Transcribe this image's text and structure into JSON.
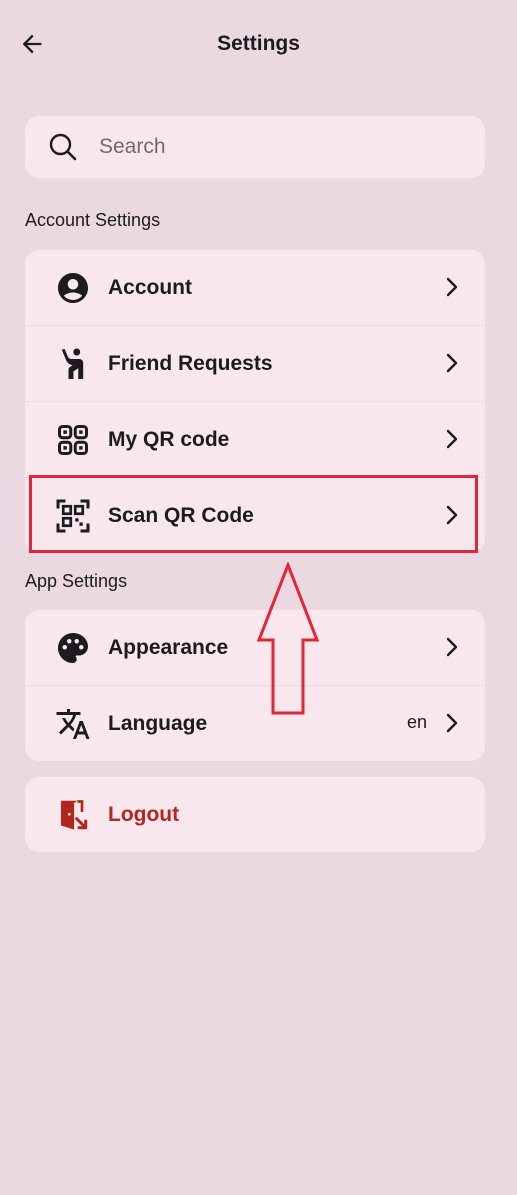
{
  "header": {
    "title": "Settings",
    "back_icon": "arrow-left-icon"
  },
  "search": {
    "placeholder": "Search",
    "value": ""
  },
  "account_section": {
    "label": "Account Settings",
    "items": [
      {
        "label": "Account",
        "icon": "account-circle-icon"
      },
      {
        "label": "Friend Requests",
        "icon": "waving-person-icon"
      },
      {
        "label": "My QR code",
        "icon": "qr-code-icon"
      },
      {
        "label": "Scan QR Code",
        "icon": "qr-scan-icon"
      }
    ]
  },
  "app_section": {
    "label": "App Settings",
    "items": [
      {
        "label": "Appearance",
        "icon": "palette-icon"
      },
      {
        "label": "Language",
        "icon": "translate-icon",
        "value": "en"
      }
    ]
  },
  "logout": {
    "label": "Logout",
    "icon": "logout-icon"
  },
  "annotation": {
    "highlight_color": "#e32636",
    "target": "Scan QR Code"
  },
  "colors": {
    "background": "#ead9e1",
    "card": "#f8e8ee",
    "logout": "#b3261e"
  }
}
